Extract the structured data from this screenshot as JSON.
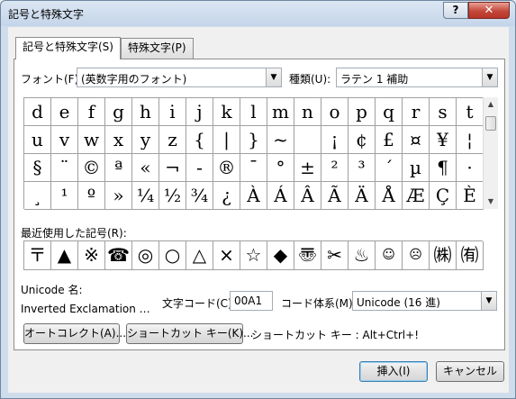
{
  "window": {
    "title": "記号と特殊文字",
    "help_label": "?",
    "close_label": "✕"
  },
  "tabs": [
    {
      "label": "記号と特殊文字(S)"
    },
    {
      "label": "特殊文字(P)"
    }
  ],
  "font": {
    "label": "フォント(F):",
    "value": "(英数字用のフォント)"
  },
  "subset": {
    "label": "種類(U):",
    "value": "ラテン 1 補助"
  },
  "symbol_grid": {
    "selected_index": 68,
    "rows": [
      [
        "d",
        "e",
        "f",
        "g",
        "h",
        "i",
        "j",
        "k",
        "l",
        "m",
        "n",
        "o",
        "p",
        "q",
        "r",
        "s",
        "t"
      ],
      [
        "u",
        "v",
        "w",
        "x",
        "y",
        "z",
        "{",
        "|",
        "}",
        "~",
        " ",
        "¡",
        "¢",
        "£",
        "¤",
        "¥",
        "¦"
      ],
      [
        "§",
        "¨",
        "©",
        "ª",
        "«",
        "¬",
        "-",
        "®",
        "¯",
        "°",
        "±",
        "²",
        "³",
        "´",
        "µ",
        "¶",
        "·"
      ],
      [
        "¸",
        "¹",
        "º",
        "»",
        "¼",
        "½",
        "¾",
        "¿",
        "À",
        "Á",
        "Â",
        "Ã",
        "Ä",
        "Å",
        "Æ",
        "Ç",
        "È"
      ]
    ]
  },
  "recent": {
    "label": "最近使用した記号(R):",
    "symbols": [
      "〒",
      "▲",
      "※",
      "☎",
      "◎",
      "○",
      "△",
      "×",
      "☆",
      "◆",
      "〠",
      "✂",
      "♨",
      "☺",
      "☹",
      "㈱",
      "㈲"
    ]
  },
  "unicode_name": {
    "label": "Unicode 名:",
    "value": "Inverted Exclamation …"
  },
  "char_code": {
    "label": "文字コード(C):",
    "value": "00A1"
  },
  "code_system": {
    "label": "コード体系(M):",
    "value": "Unicode (16 進)"
  },
  "buttons": {
    "autocorrect": "オートコレクト(A)...",
    "shortcut": "ショートカット キー(K)...",
    "insert": "挿入(I)",
    "cancel": "キャンセル"
  },
  "shortcut_info": "ショートカット キー : Alt+Ctrl+!"
}
